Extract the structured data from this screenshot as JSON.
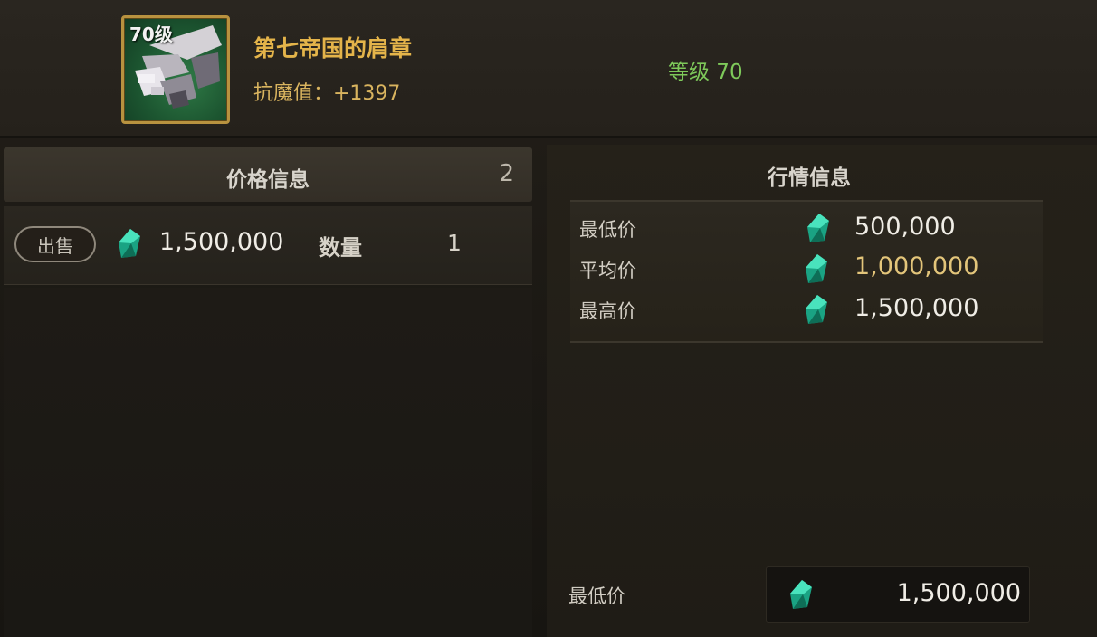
{
  "item": {
    "slot_level": "70级",
    "name": "第七帝国的肩章",
    "stat": "抗魔值：+1397",
    "level_text": "等级 70",
    "icon": "shoulder-armor-icon"
  },
  "price_panel": {
    "title": "价格信息",
    "count": "2",
    "listing": {
      "sell_label": "出售",
      "price": "1,500,000",
      "qty_label": "数量",
      "qty": "1",
      "currency_icon": "gem-icon"
    }
  },
  "market_panel": {
    "title": "行情信息",
    "rows": [
      {
        "label": "最低价",
        "value": "500,000"
      },
      {
        "label": "平均价",
        "value": "1,000,000"
      },
      {
        "label": "最高价",
        "value": "1,500,000"
      }
    ],
    "bottom_label": "最低价",
    "bottom_value": "1,500,000"
  },
  "colors": {
    "accent_gold": "#e4b44a",
    "level_green": "#7ec95a",
    "average_price": "#e3c57a",
    "gem_teal": "#2fd0a6"
  }
}
